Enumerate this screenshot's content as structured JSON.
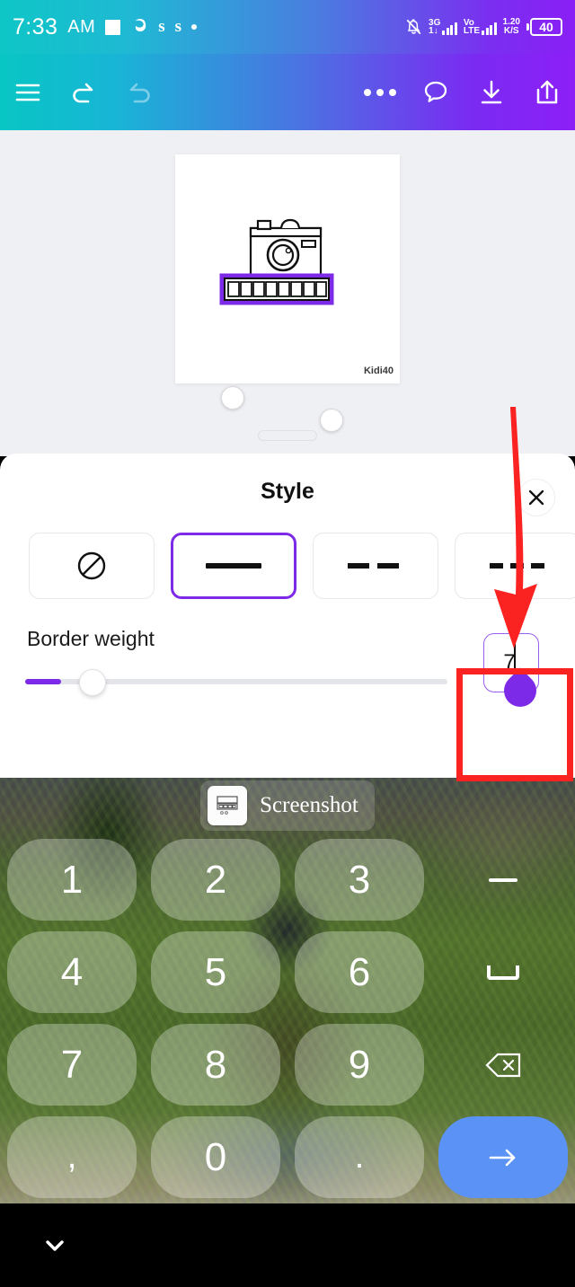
{
  "status_bar": {
    "time": "7:33",
    "ampm": "AM",
    "icons": [
      "white-square-icon",
      "edge-browser-icon",
      "s-app-icon",
      "s-app-icon-2",
      "dot-icon"
    ],
    "notification_muted_icon": "bell-mute-icon",
    "network_type": "3G",
    "network_sub": "1↓",
    "volte": "Vo",
    "volte_sub": "LTE",
    "data_rate": "1.20",
    "data_rate_unit": "K/S",
    "battery_percent": "40"
  },
  "toolbar": {
    "menu_icon": "hamburger-menu-icon",
    "undo_icon": "undo-icon",
    "redo_icon": "redo-icon",
    "more_icon": "more-options-icon",
    "comment_icon": "comment-bubble-icon",
    "download_icon": "download-icon",
    "share_icon": "share-icon"
  },
  "canvas": {
    "watermark": "Kidi40",
    "selected_element": "film-strip-shape",
    "rotate_icon": "rotate-icon",
    "move_icon": "move-icon",
    "handle_top_left": "resize-handle",
    "handle_bottom_right": "resize-handle"
  },
  "style_panel": {
    "title": "Style",
    "close_icon": "close-icon",
    "accent_color": "#7d2ae8",
    "border_styles": [
      {
        "name": "none",
        "glyph": "no-border-icon",
        "selected": false
      },
      {
        "name": "solid",
        "glyph": "solid-line",
        "selected": true
      },
      {
        "name": "dashed-large",
        "glyph": "long-dash-line",
        "selected": false
      },
      {
        "name": "dashed-medium",
        "glyph": "medium-dash-line",
        "selected": false
      },
      {
        "name": "dotted",
        "glyph": "dotted-line",
        "selected": false
      }
    ],
    "border_weight": {
      "label": "Border weight",
      "value": "7",
      "slider_min": 0,
      "slider_max": 100,
      "slider_position_percent": 9
    }
  },
  "keyboard": {
    "suggestion": {
      "label": "Screenshot",
      "thumb_icon": "screenshot-thumb-icon"
    },
    "keys": [
      {
        "label": "1",
        "name": "key-1",
        "type": "digit"
      },
      {
        "label": "2",
        "name": "key-2",
        "type": "digit"
      },
      {
        "label": "3",
        "name": "key-3",
        "type": "digit"
      },
      {
        "label": "−",
        "name": "key-minus",
        "type": "fn"
      },
      {
        "label": "4",
        "name": "key-4",
        "type": "digit"
      },
      {
        "label": "5",
        "name": "key-5",
        "type": "digit"
      },
      {
        "label": "6",
        "name": "key-6",
        "type": "digit"
      },
      {
        "label": "␣",
        "name": "key-space",
        "type": "fn"
      },
      {
        "label": "7",
        "name": "key-7",
        "type": "digit"
      },
      {
        "label": "8",
        "name": "key-8",
        "type": "digit"
      },
      {
        "label": "9",
        "name": "key-9",
        "type": "digit"
      },
      {
        "label": "⌫",
        "name": "key-backspace",
        "type": "fn"
      },
      {
        "label": ",",
        "name": "key-comma",
        "type": "digit"
      },
      {
        "label": "0",
        "name": "key-0",
        "type": "digit"
      },
      {
        "label": ".",
        "name": "key-period",
        "type": "digit"
      },
      {
        "label": "→",
        "name": "key-enter",
        "type": "enter"
      }
    ],
    "enter_color": "#5a93f5"
  },
  "nav_bar": {
    "hide_keyboard_icon": "chevron-down-icon"
  },
  "annotations": {
    "arrow_color": "#fb2222",
    "box_color": "#fb2222",
    "arrow_target": "border-weight-input",
    "box_target": "border-weight-input"
  }
}
